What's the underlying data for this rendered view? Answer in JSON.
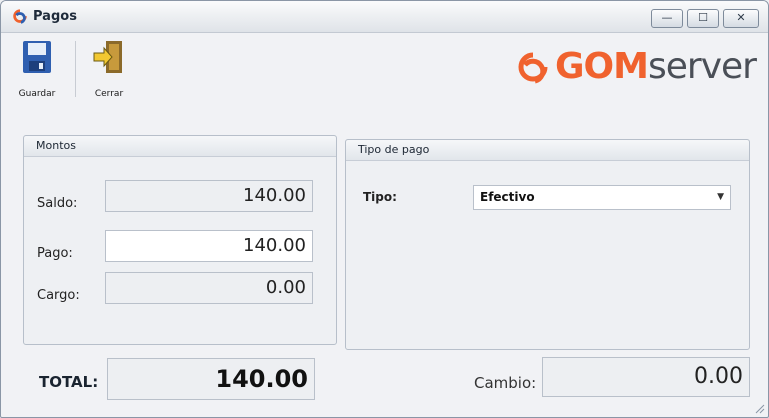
{
  "window": {
    "title": "Pagos"
  },
  "title_buttons": {
    "minimize": "—",
    "maximize": "☐",
    "close": "✕"
  },
  "toolbar": {
    "save_label": "Guardar",
    "close_label": "Cerrar"
  },
  "logo": {
    "brand_highlight": "GOM",
    "brand_rest": "server"
  },
  "montos": {
    "title": "Montos",
    "saldo_label": "Saldo:",
    "saldo_value": "140.00",
    "pago_label": "Pago:",
    "pago_value": "140.00",
    "cargo_label": "Cargo:",
    "cargo_value": "0.00"
  },
  "tipo_pago": {
    "title": "Tipo de pago",
    "tipo_label": "Tipo:",
    "tipo_selected": "Efectivo"
  },
  "footer": {
    "total_label": "TOTAL:",
    "total_value": "140.00",
    "cambio_label": "Cambio:",
    "cambio_value": "0.00"
  },
  "colors": {
    "accent": "#f0622e",
    "brand_gray": "#4a4f57",
    "save_icon": "#2f5fb0"
  }
}
